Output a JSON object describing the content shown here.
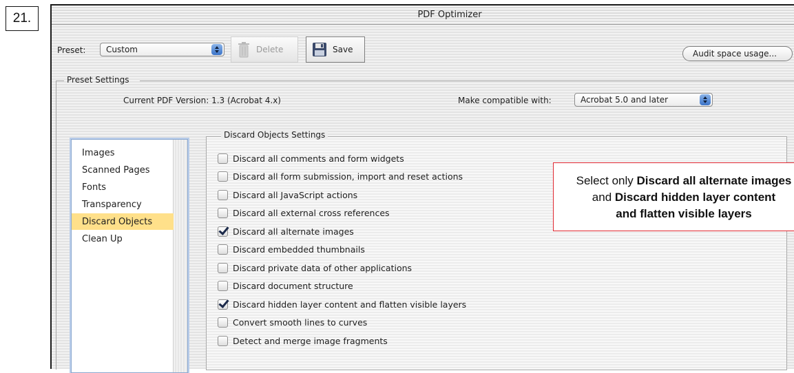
{
  "step_number": "21.",
  "window": {
    "title": "PDF Optimizer"
  },
  "toolbar": {
    "preset_label": "Preset:",
    "preset_value": "Custom",
    "delete_label": "Delete",
    "save_label": "Save",
    "audit_label": "Audit space usage..."
  },
  "preset_settings": {
    "group_label": "Preset Settings",
    "current_version": "Current PDF Version: 1.3 (Acrobat 4.x)",
    "compat_label": "Make compatible with:",
    "compat_value": "Acrobat 5.0 and later"
  },
  "categories": [
    {
      "label": "Images",
      "selected": false
    },
    {
      "label": "Scanned Pages",
      "selected": false
    },
    {
      "label": "Fonts",
      "selected": false
    },
    {
      "label": "Transparency",
      "selected": false
    },
    {
      "label": "Discard Objects",
      "selected": true
    },
    {
      "label": "Clean Up",
      "selected": false
    }
  ],
  "discard_settings": {
    "group_label": "Discard Objects Settings",
    "options": [
      {
        "label": "Discard all comments and form widgets",
        "checked": false
      },
      {
        "label": "Discard all form submission, import and reset actions",
        "checked": false
      },
      {
        "label": "Discard all JavaScript actions",
        "checked": false
      },
      {
        "label": "Discard all external cross references",
        "checked": false
      },
      {
        "label": "Discard all alternate images",
        "checked": true
      },
      {
        "label": "Discard embedded thumbnails",
        "checked": false
      },
      {
        "label": "Discard  private data of other applications",
        "checked": false
      },
      {
        "label": "Discard document structure",
        "checked": false
      },
      {
        "label": "Discard hidden layer content and flatten visible layers",
        "checked": true
      },
      {
        "label": "Convert smooth lines to curves",
        "checked": false
      },
      {
        "label": "Detect and merge image fragments",
        "checked": false
      }
    ]
  },
  "callout": {
    "line1_plain": "Select only ",
    "line1_bold": "Discard all alternate images",
    "line2_plain": "and ",
    "line2_bold": "Discard hidden layer content",
    "line3_bold": "and flatten visible layers"
  },
  "colors": {
    "callout_border": "#e0262f",
    "selection": "#ffe08a",
    "popup_arrow": "#3c74c9"
  }
}
